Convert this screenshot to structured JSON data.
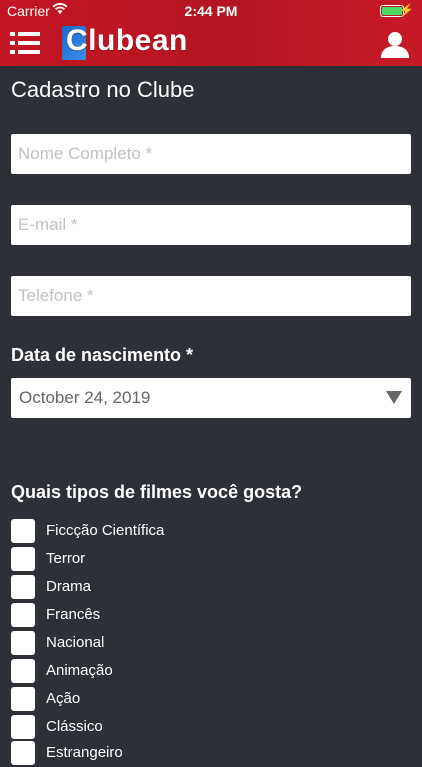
{
  "status": {
    "carrier": "Carrier",
    "time": "2:44 PM",
    "wifi_icon": "wifi-icon",
    "battery_icon": "battery-icon"
  },
  "header": {
    "brand": "Clubean",
    "menu_icon": "menu-icon",
    "user_icon": "user-icon",
    "color": "#c41522"
  },
  "page": {
    "title": "Cadastro no Clube"
  },
  "form": {
    "name_placeholder": "Nome Completo *",
    "email_placeholder": "E-mail *",
    "phone_placeholder": "Telefone *",
    "birth_label": "Data de nascimento *",
    "birth_value": "October 24, 2019",
    "movies_label": "Quais tipos de filmes você gosta?",
    "movie_types": [
      "Ficcção Científica",
      "Terror",
      "Drama",
      "Francês",
      "Nacional",
      "Animação",
      "Ação",
      "Clássico",
      "Estrangeiro"
    ]
  }
}
